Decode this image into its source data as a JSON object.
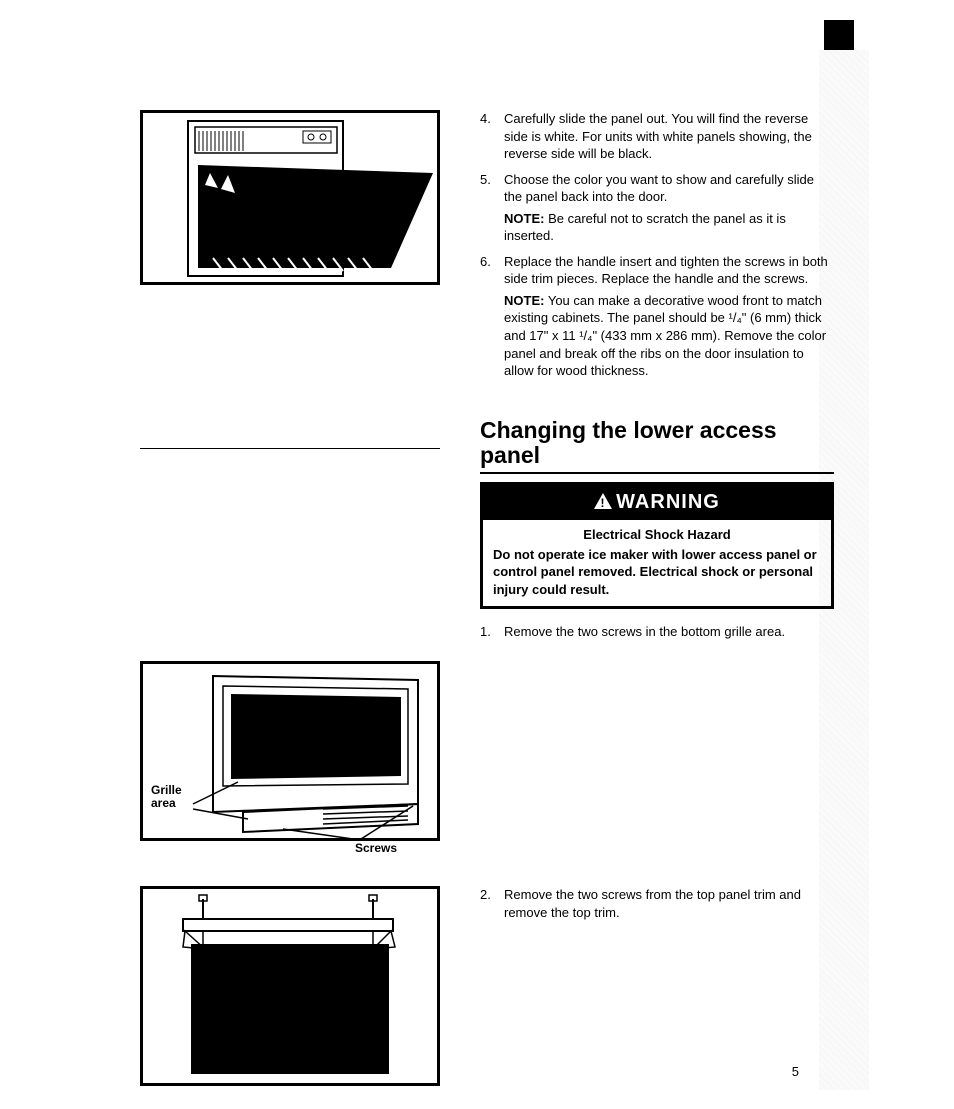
{
  "top_steps": [
    {
      "num": "4.",
      "text": "Carefully slide the panel out. You will find the reverse side is white. For units with white panels showing, the reverse side will be black."
    },
    {
      "num": "5.",
      "text": "Choose the color you want to show and carefully slide the panel back into the door.",
      "note": "Be careful not to scratch the panel as it is inserted."
    },
    {
      "num": "6.",
      "text": "Replace the handle insert and tighten the screws in both side trim pieces. Replace the handle and the screws.",
      "note": "You can make a decorative wood front to match existing cabinets. The panel should be ¹/₄\" (6 mm) thick and 17\" x 11 ¹/₄\" (433 mm x 286 mm). Remove the color panel and break off the ribs on the door insulation to allow for wood thickness."
    }
  ],
  "note_label": "NOTE:",
  "section_title": "Changing the lower access panel",
  "warning": {
    "header": "WARNING",
    "title": "Electrical Shock Hazard",
    "body": "Do not operate ice maker with lower access panel or control panel removed. Electrical shock or personal injury could result."
  },
  "lower_steps": [
    {
      "num": "1.",
      "text": "Remove the two screws in the bottom grille area."
    },
    {
      "num": "2.",
      "text": "Remove the two screws from the top panel trim and remove the top trim."
    }
  ],
  "fig2_labels": {
    "grille1": "Grille",
    "grille2": "area",
    "screws": "Screws"
  },
  "page_number": "5"
}
